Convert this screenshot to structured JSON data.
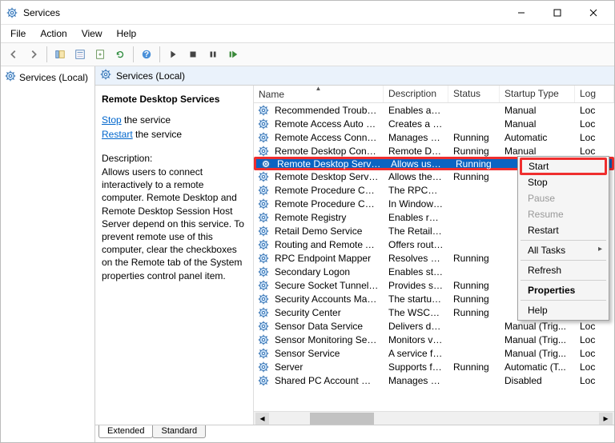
{
  "window": {
    "title": "Services"
  },
  "menubar": [
    "File",
    "Action",
    "View",
    "Help"
  ],
  "toolbar_buttons": [
    "back",
    "forward",
    "up",
    "show-hide",
    "properties",
    "export",
    "refresh",
    "help",
    "play",
    "stop",
    "pause",
    "restart"
  ],
  "tree": {
    "root": "Services (Local)"
  },
  "header_bar": {
    "title": "Services (Local)"
  },
  "info_pane": {
    "service_name": "Remote Desktop Services",
    "stop_link": "Stop",
    "stop_suffix": " the service",
    "restart_link": "Restart",
    "restart_suffix": " the service",
    "description_label": "Description:",
    "description_text": "Allows users to connect interactively to a remote computer. Remote Desktop and Remote Desktop Session Host Server depend on this service. To prevent remote use of this computer, clear the checkboxes on the Remote tab of the System properties control panel item."
  },
  "columns": {
    "name": "Name",
    "description": "Description",
    "status": "Status",
    "startup": "Startup Type",
    "logon": "Log"
  },
  "services": [
    {
      "name": "Recommended Troublesho...",
      "desc": "Enables aut...",
      "status": "",
      "startup": "Manual",
      "log": "Loc"
    },
    {
      "name": "Remote Access Auto Conne...",
      "desc": "Creates a co...",
      "status": "",
      "startup": "Manual",
      "log": "Loc"
    },
    {
      "name": "Remote Access Connection...",
      "desc": "Manages di...",
      "status": "Running",
      "startup": "Automatic",
      "log": "Loc"
    },
    {
      "name": "Remote Desktop Configurat...",
      "desc": "Remote Des...",
      "status": "Running",
      "startup": "Manual",
      "log": "Loc"
    },
    {
      "name": "Remote Desktop Services",
      "desc": "Allows user...",
      "status": "Running",
      "startup": "",
      "log": "",
      "selected": true,
      "highlight": true
    },
    {
      "name": "Remote Desktop Services U...",
      "desc": "Allows the r...",
      "status": "Running",
      "startup": "",
      "log": ""
    },
    {
      "name": "Remote Procedure Call (RPC)",
      "desc": "The RPCSS s...",
      "status": "",
      "startup": "",
      "log": ""
    },
    {
      "name": "Remote Procedure Call (RP...",
      "desc": "In Windows...",
      "status": "",
      "startup": "",
      "log": ""
    },
    {
      "name": "Remote Registry",
      "desc": "Enables rem...",
      "status": "",
      "startup": "",
      "log": ""
    },
    {
      "name": "Retail Demo Service",
      "desc": "The Retail D...",
      "status": "",
      "startup": "",
      "log": ""
    },
    {
      "name": "Routing and Remote Access",
      "desc": "Offers routi...",
      "status": "",
      "startup": "",
      "log": ""
    },
    {
      "name": "RPC Endpoint Mapper",
      "desc": "Resolves RP...",
      "status": "Running",
      "startup": "",
      "log": ""
    },
    {
      "name": "Secondary Logon",
      "desc": "Enables star...",
      "status": "",
      "startup": "",
      "log": ""
    },
    {
      "name": "Secure Socket Tunneling Pr...",
      "desc": "Provides su...",
      "status": "Running",
      "startup": "",
      "log": ""
    },
    {
      "name": "Security Accounts Manager",
      "desc": "The startup ...",
      "status": "Running",
      "startup": "",
      "log": ""
    },
    {
      "name": "Security Center",
      "desc": "The WSCSV...",
      "status": "Running",
      "startup": "",
      "log": ""
    },
    {
      "name": "Sensor Data Service",
      "desc": "Delivers dat...",
      "status": "",
      "startup": "Manual (Trig...",
      "log": "Loc"
    },
    {
      "name": "Sensor Monitoring Service",
      "desc": "Monitors va...",
      "status": "",
      "startup": "Manual (Trig...",
      "log": "Loc"
    },
    {
      "name": "Sensor Service",
      "desc": "A service fo...",
      "status": "",
      "startup": "Manual (Trig...",
      "log": "Loc"
    },
    {
      "name": "Server",
      "desc": "Supports fil...",
      "status": "Running",
      "startup": "Automatic (T...",
      "log": "Loc"
    },
    {
      "name": "Shared PC Account Manager",
      "desc": "Manages pr...",
      "status": "",
      "startup": "Disabled",
      "log": "Loc"
    }
  ],
  "context_menu": [
    {
      "label": "Start",
      "highlight": true
    },
    {
      "label": "Stop"
    },
    {
      "label": "Pause",
      "disabled": true
    },
    {
      "label": "Resume",
      "disabled": true
    },
    {
      "label": "Restart"
    },
    {
      "sep": true
    },
    {
      "label": "All Tasks",
      "sub": true
    },
    {
      "sep": true
    },
    {
      "label": "Refresh"
    },
    {
      "sep": true
    },
    {
      "label": "Properties",
      "bold": true
    },
    {
      "sep": true
    },
    {
      "label": "Help"
    }
  ],
  "tabs": {
    "extended": "Extended",
    "standard": "Standard"
  }
}
